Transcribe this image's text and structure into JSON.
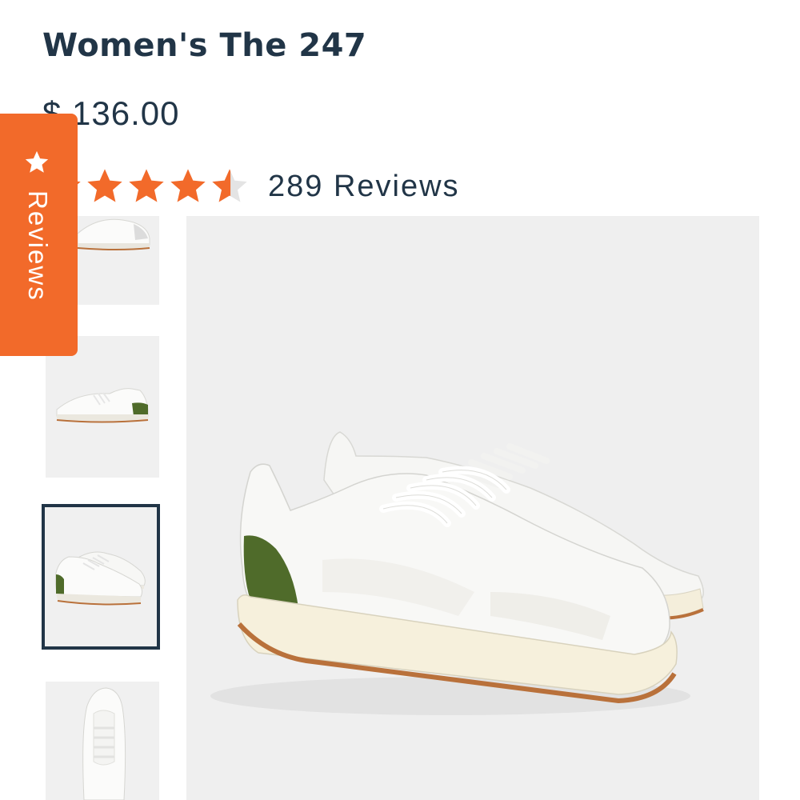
{
  "product": {
    "title": "Women's The 247",
    "price": "$ 136.00",
    "rating": 4.5,
    "rating_max": 5,
    "review_count_label": "289 Reviews"
  },
  "reviews_tab": {
    "label": "Reviews",
    "icon": "star-icon"
  },
  "gallery": {
    "selected_index": 2,
    "thumbnails": [
      {
        "name": "thumbnail-side-view"
      },
      {
        "name": "thumbnail-side-green-heel"
      },
      {
        "name": "thumbnail-pair-angle"
      },
      {
        "name": "thumbnail-top-view"
      }
    ]
  },
  "colors": {
    "brand_navy": "#213547",
    "accent_orange": "#f26a2a",
    "star_orange": "#f26a2a",
    "heel_green": "#4f6b2a",
    "gum_sole": "#b9713b",
    "image_bg": "#efefef"
  }
}
